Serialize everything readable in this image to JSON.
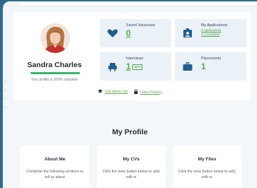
{
  "profile": {
    "name": "Sandra Charles",
    "progress_text": "Your profile is 100% complete",
    "progress_fraction": 1.0,
    "progress_color": "#3bb46b"
  },
  "tiles": {
    "saved_vacancies": {
      "label": "Saved Vacancies",
      "value": "0",
      "icon": "heart-icon"
    },
    "my_applications": {
      "label": "My Applications",
      "links": [
        "3 Applications",
        "3 Incomplete"
      ],
      "icon": "id-badge-icon"
    },
    "interviews": {
      "label": "Interviews",
      "value": "1",
      "badge": "NEW",
      "icon": "armchair-icon"
    },
    "placements": {
      "label": "Placements",
      "value": "1",
      "icon": "briefcase-icon"
    }
  },
  "links": {
    "job_alerts": "Job Alerts On",
    "data_privacy": "Data Privacy"
  },
  "my_profile": {
    "title": "My Profile",
    "cards": [
      {
        "title": "About Me",
        "desc": "Complete the following sections to tell us about"
      },
      {
        "title": "My CVs",
        "desc": "Click the view button below to add, edit or"
      },
      {
        "title": "My Files",
        "desc": "Click the view button below to add, edit or"
      }
    ]
  },
  "colors": {
    "accent_green": "#50b13f",
    "icon_blue": "#1f5f8f",
    "tile_bg": "#eaf1f7",
    "page_bg": "#2f6a90"
  }
}
